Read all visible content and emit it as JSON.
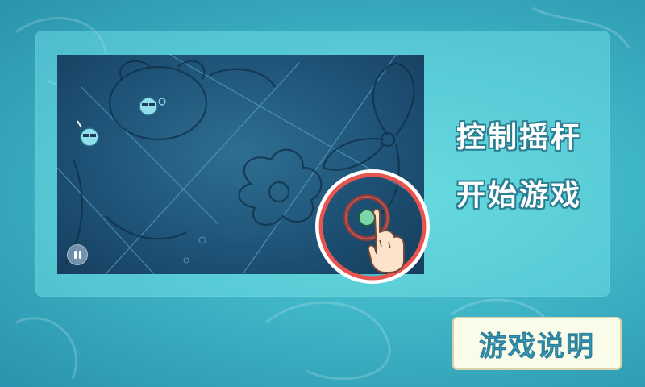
{
  "instructions": {
    "joystick_label": "控制摇杆",
    "start_label": "开始游戏"
  },
  "help_button": {
    "label": "游戏说明"
  },
  "preview": {
    "pause_icon": "pause-icon",
    "joystick_icon": "joystick-icon",
    "hand_icon": "pointing-hand-icon"
  },
  "colors": {
    "background": "#3fb6c6",
    "panel": "#7be6eb",
    "preview_bg": "#1f5478",
    "highlight_ring": "#e8544f",
    "label_text": "#ffffff",
    "help_button_bg": "#fbfbea",
    "help_button_text": "#3aa0bf"
  }
}
